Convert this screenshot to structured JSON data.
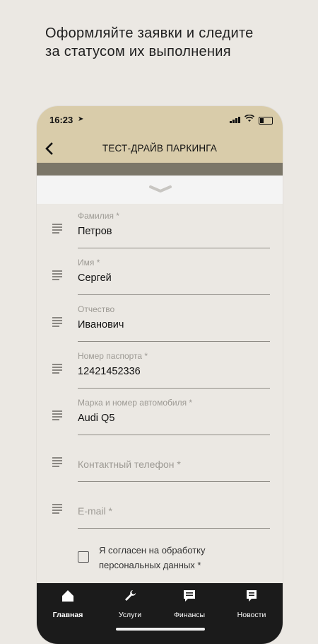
{
  "promo": {
    "line1": "Оформляйте заявки и следите",
    "line2": "за статусом их выполнения"
  },
  "status_bar": {
    "time": "16:23"
  },
  "header": {
    "title": "ТЕСТ-ДРАЙВ ПАРКИНГА",
    "back_icon": "chevron-left-icon"
  },
  "form": {
    "fields": [
      {
        "label": "Фамилия *",
        "value": "Петров"
      },
      {
        "label": "Имя *",
        "value": "Сергей"
      },
      {
        "label": "Отчество",
        "value": "Иванович"
      },
      {
        "label": "Номер паспорта *",
        "value": "12421452336"
      },
      {
        "label": "Марка и номер автомобиля *",
        "value": "Audi Q5"
      },
      {
        "label": "Контактный телефон *",
        "value": ""
      },
      {
        "label": "E-mail *",
        "value": ""
      }
    ],
    "consent": {
      "line1": "Я согласен на обработку",
      "line2": "персональных данных *",
      "checked": false
    }
  },
  "tabs": [
    {
      "label": "Главная",
      "icon": "home-icon"
    },
    {
      "label": "Услуги",
      "icon": "wrench-icon"
    },
    {
      "label": "Финансы",
      "icon": "finance-chat-icon"
    },
    {
      "label": "Новости",
      "icon": "news-icon"
    }
  ],
  "colors": {
    "header_bg": "#d9ccaa",
    "strip": "#7b7668",
    "page_bg": "#ebe8e3",
    "tabbar_bg": "#1b1b1b"
  }
}
